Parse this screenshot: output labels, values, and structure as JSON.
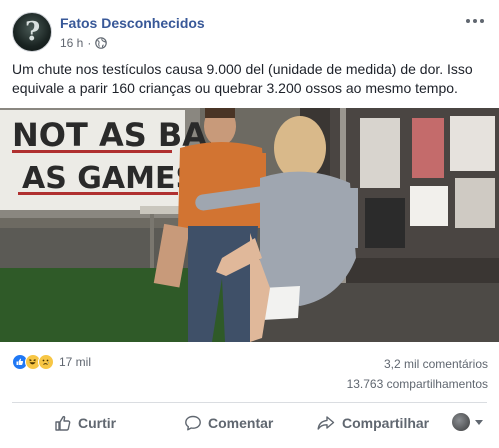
{
  "post": {
    "page_name": "Fatos Desconhecidos",
    "time": "16 h",
    "separator": "·",
    "privacy_icon": "globe-icon",
    "text": "Um chute nos testículos causa 9.000 del (unidade de medida) de dor. Isso equivale a parir 160 crianças ou quebrar 3.200 ossos ao mesmo tempo.",
    "image": {
      "sign_line1": "NOT AS BAD",
      "sign_line2": "AS GAMESTO"
    }
  },
  "reactions": {
    "icons": [
      "like-icon",
      "haha-icon",
      "sad-icon"
    ],
    "count": "17 mil"
  },
  "stats": {
    "comments": "3,2 mil comentários",
    "shares": "13.763 compartilhamentos"
  },
  "actions": {
    "like": "Curtir",
    "comment": "Comentar",
    "share": "Compartilhar"
  },
  "colors": {
    "page_name": "#385898",
    "meta": "#616770",
    "like_blue": "#2078f4",
    "divider": "#dadde1"
  }
}
